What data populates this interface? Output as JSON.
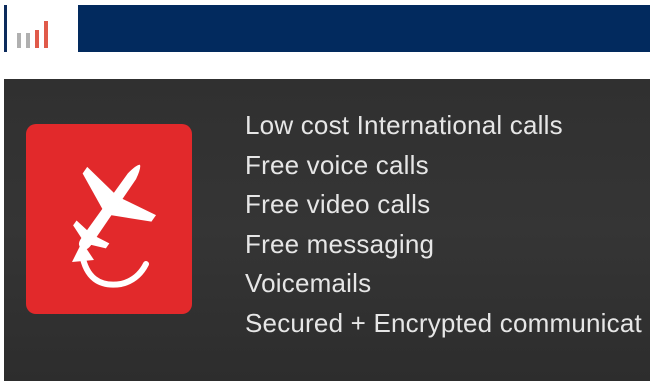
{
  "header": {
    "bar_color": "#022a5e"
  },
  "thumbnail": {
    "bars": [
      {
        "value": 0.55,
        "color": "#b0b0b0"
      },
      {
        "value": 0.55,
        "color": "#b0b0b0"
      },
      {
        "value": 0.65,
        "color": "#e05a4a"
      },
      {
        "value": 0.95,
        "color": "#e05a4a"
      }
    ]
  },
  "banner": {
    "icon": "airplane-return-icon",
    "icon_color": "#e2292b",
    "features": [
      "Low cost International calls",
      "Free voice calls",
      "Free video calls",
      "Free messaging",
      "Voicemails",
      "Secured + Encrypted communicat"
    ]
  }
}
